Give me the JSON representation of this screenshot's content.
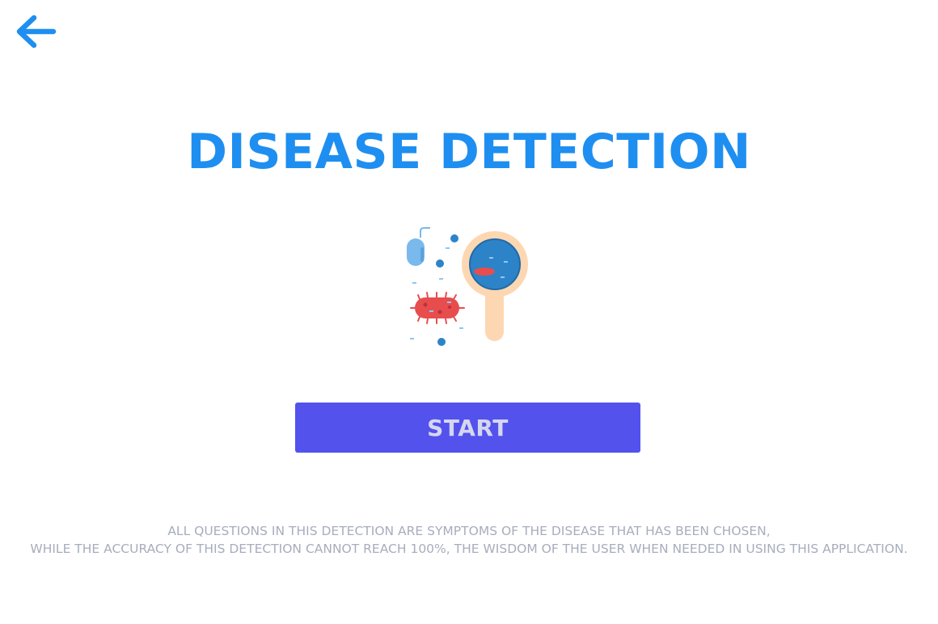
{
  "header": {
    "back_icon": "arrow-left-icon"
  },
  "main": {
    "title": "DISEASE DETECTION",
    "illustration_icon": "bacteria-magnifier-illustration",
    "start_label": "START",
    "disclaimer_line1": "ALL QUESTIONS IN THIS DETECTION ARE SYMPTOMS OF THE DISEASE THAT HAS BEEN CHOSEN,",
    "disclaimer_line2": "WHILE THE ACCURACY OF THIS DETECTION CANNOT REACH 100%, THE WISDOM OF THE USER WHEN NEEDED IN USING THIS APPLICATION."
  },
  "colors": {
    "accent": "#1e8ff0",
    "button_bg": "#5352ed",
    "button_text": "#d5d7ee",
    "disclaimer_text": "#a7adbd",
    "germ_red": "#e84d4d",
    "lens_blue": "#2d83c8",
    "handle_peach": "#fdd7b2"
  }
}
